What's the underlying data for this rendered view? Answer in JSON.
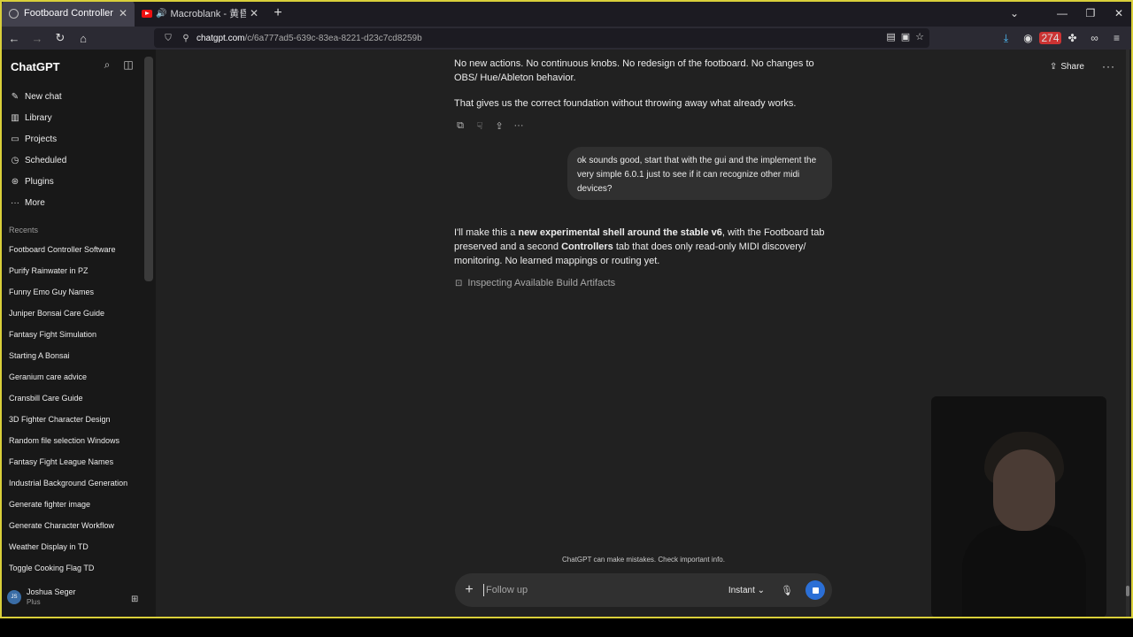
{
  "browser": {
    "tabs": [
      {
        "title": "Footboard Controller Software",
        "active": true
      },
      {
        "title": "Macroblank - 黄昏時 COLL",
        "active": false
      }
    ],
    "url_domain": "chatgpt.com",
    "url_path": "/c/6a777ad5-639c-83ea-8221-d23c7cd8259b",
    "extensions_badge": "274"
  },
  "sidebar": {
    "brand": "ChatGPT",
    "nav": [
      {
        "label": "New chat",
        "icon": "edit-icon"
      },
      {
        "label": "Library",
        "icon": "library-icon"
      },
      {
        "label": "Projects",
        "icon": "folder-icon"
      },
      {
        "label": "Scheduled",
        "icon": "clock-icon"
      },
      {
        "label": "Plugins",
        "icon": "plugin-icon"
      },
      {
        "label": "More",
        "icon": "more-icon"
      }
    ],
    "recents_label": "Recents",
    "recents": [
      "Footboard Controller Software",
      "Purify Rainwater in PZ",
      "Funny Emo Guy Names",
      "Juniper Bonsai Care Guide",
      "Fantasy Fight Simulation",
      "Starting A Bonsai",
      "Geranium care advice",
      "Cransbill Care Guide",
      "3D Fighter Character Design",
      "Random file selection Windows",
      "Fantasy Fight League Names",
      "Industrial Background Generation",
      "Generate fighter image",
      "Generate Character Workflow",
      "Weather Display in TD",
      "Toggle Cooking Flag TD"
    ],
    "user": {
      "initials": "JS",
      "name": "Joshua Seger",
      "plan": "Plus"
    }
  },
  "main": {
    "share_label": "Share",
    "para1": "No new actions. No continuous knobs. No redesign of the footboard. No changes to OBS/ Hue/Ableton behavior.",
    "para2": "That gives us the correct foundation without throwing away what already works.",
    "user_message": "ok sounds good, start that with the gui and the implement the very simple 6.0.1 just to see if it can recognize other midi devices?",
    "reply_part1": "I'll make this a ",
    "reply_bold1": "new experimental shell around the stable v6",
    "reply_part2": ", with the Footboard tab preserved and a second ",
    "reply_bold2": "Controllers",
    "reply_part3": " tab that does only read-only MIDI discovery/ monitoring. No learned mappings or routing yet.",
    "status": "Inspecting Available Build Artifacts",
    "disclaimer": "ChatGPT can make mistakes. Check important info.",
    "composer_placeholder": "Follow up",
    "model_mode": "Instant"
  },
  "colors": {
    "accent_blue": "#2b6fd6",
    "sidebar_bg": "#181818",
    "main_bg": "#212121",
    "bubble_bg": "#303030"
  }
}
